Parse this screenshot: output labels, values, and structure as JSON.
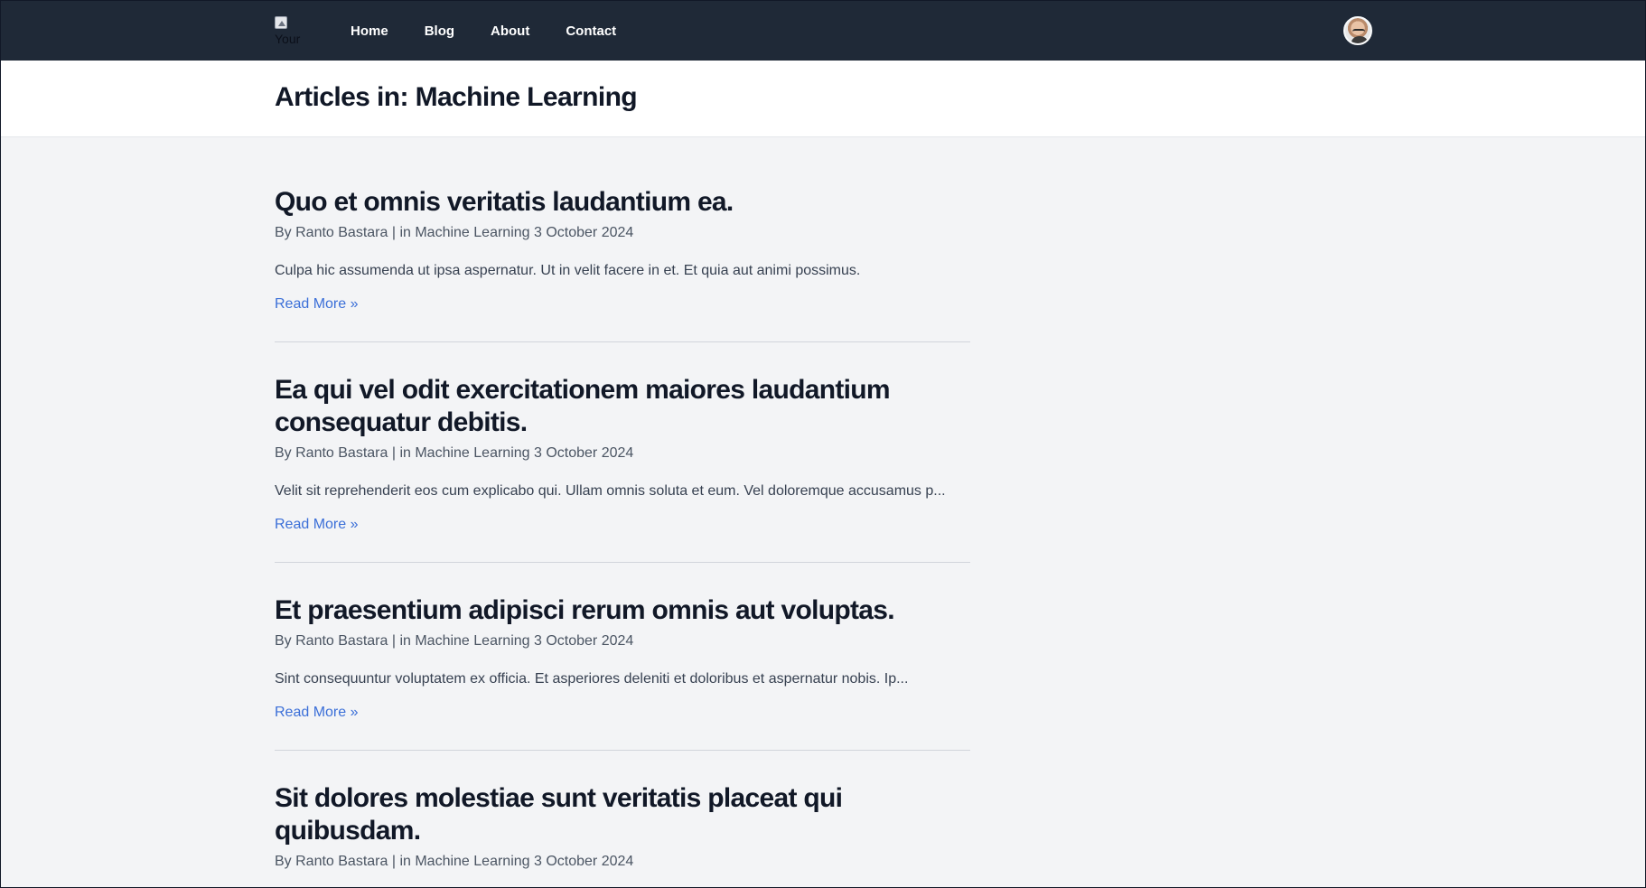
{
  "nav": {
    "logo_alt": "Your",
    "links": [
      {
        "label": "Home"
      },
      {
        "label": "Blog"
      },
      {
        "label": "About"
      },
      {
        "label": "Contact"
      }
    ]
  },
  "header": {
    "title": "Articles in: Machine Learning"
  },
  "articles": [
    {
      "title": "Quo et omnis veritatis laudantium ea.",
      "meta": "By Ranto Bastara | in Machine Learning 3 October 2024",
      "excerpt": "Culpa hic assumenda ut ipsa aspernatur. Ut in velit facere in et. Et quia aut animi possimus.",
      "read_more": "Read More »"
    },
    {
      "title": "Ea qui vel odit exercitationem maiores laudantium consequatur debitis.",
      "meta": "By Ranto Bastara | in Machine Learning 3 October 2024",
      "excerpt": "Velit sit reprehenderit eos cum explicabo qui. Ullam omnis soluta et eum. Vel doloremque accusamus p...",
      "read_more": "Read More »"
    },
    {
      "title": "Et praesentium adipisci rerum omnis aut voluptas.",
      "meta": "By Ranto Bastara | in Machine Learning 3 October 2024",
      "excerpt": "Sint consequuntur voluptatem ex officia. Et asperiores deleniti et doloribus et aspernatur nobis. Ip...",
      "read_more": "Read More »"
    },
    {
      "title": "Sit dolores molestiae sunt veritatis placeat qui quibusdam.",
      "meta": "By Ranto Bastara | in Machine Learning 3 October 2024",
      "excerpt": "",
      "read_more": ""
    }
  ]
}
